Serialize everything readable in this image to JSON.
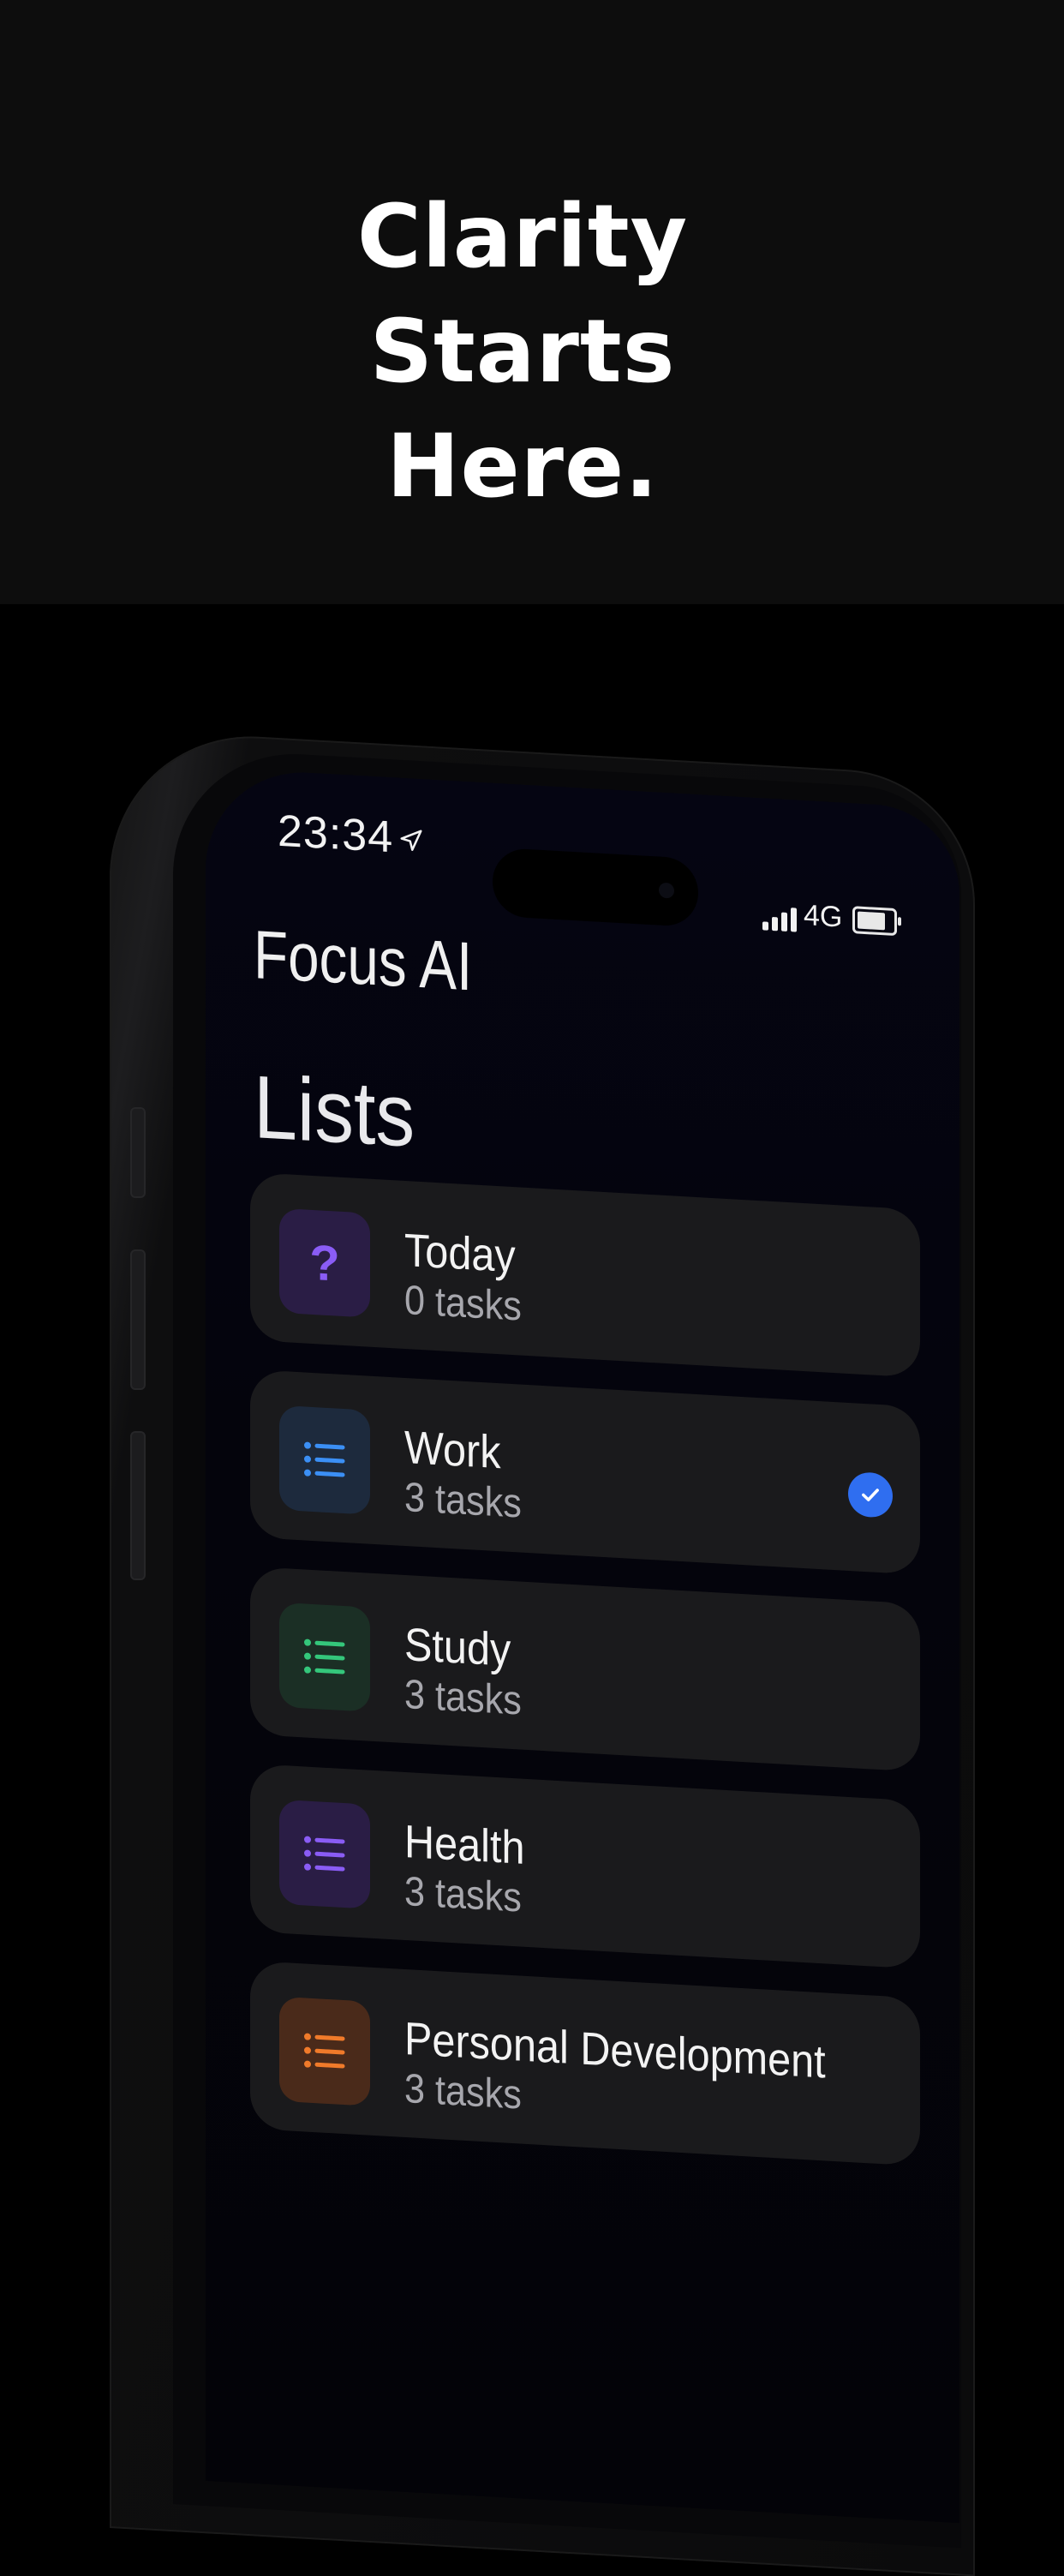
{
  "hero": {
    "line1": "Clarity",
    "line2": "Starts",
    "line3": "Here."
  },
  "status_bar": {
    "time": "23:34",
    "location_icon": "location-arrow-icon",
    "network": "4G",
    "signal_icon": "signal-bars-icon",
    "battery_icon": "battery-icon"
  },
  "app": {
    "title": "Focus AI",
    "section_title": "Lists"
  },
  "lists": [
    {
      "name": "Today",
      "count": "0 tasks",
      "icon": "question-mark-icon",
      "color": "#8a5cf5",
      "bg": "#2a1d45",
      "selected": false
    },
    {
      "name": "Work",
      "count": "3 tasks",
      "icon": "list-icon",
      "color": "#3b8ff5",
      "bg": "#1d2a3d",
      "selected": true
    },
    {
      "name": "Study",
      "count": "3 tasks",
      "icon": "list-icon",
      "color": "#34c77b",
      "bg": "#1b2f25",
      "selected": false
    },
    {
      "name": "Health",
      "count": "3 tasks",
      "icon": "list-icon",
      "color": "#8a5cf5",
      "bg": "#2a1d45",
      "selected": false
    },
    {
      "name": "Personal Development",
      "count": "3 tasks",
      "icon": "list-icon",
      "color": "#f07a2a",
      "bg": "#4a2a1a",
      "selected": false
    }
  ],
  "colors": {
    "check": "#2f6ef0"
  }
}
